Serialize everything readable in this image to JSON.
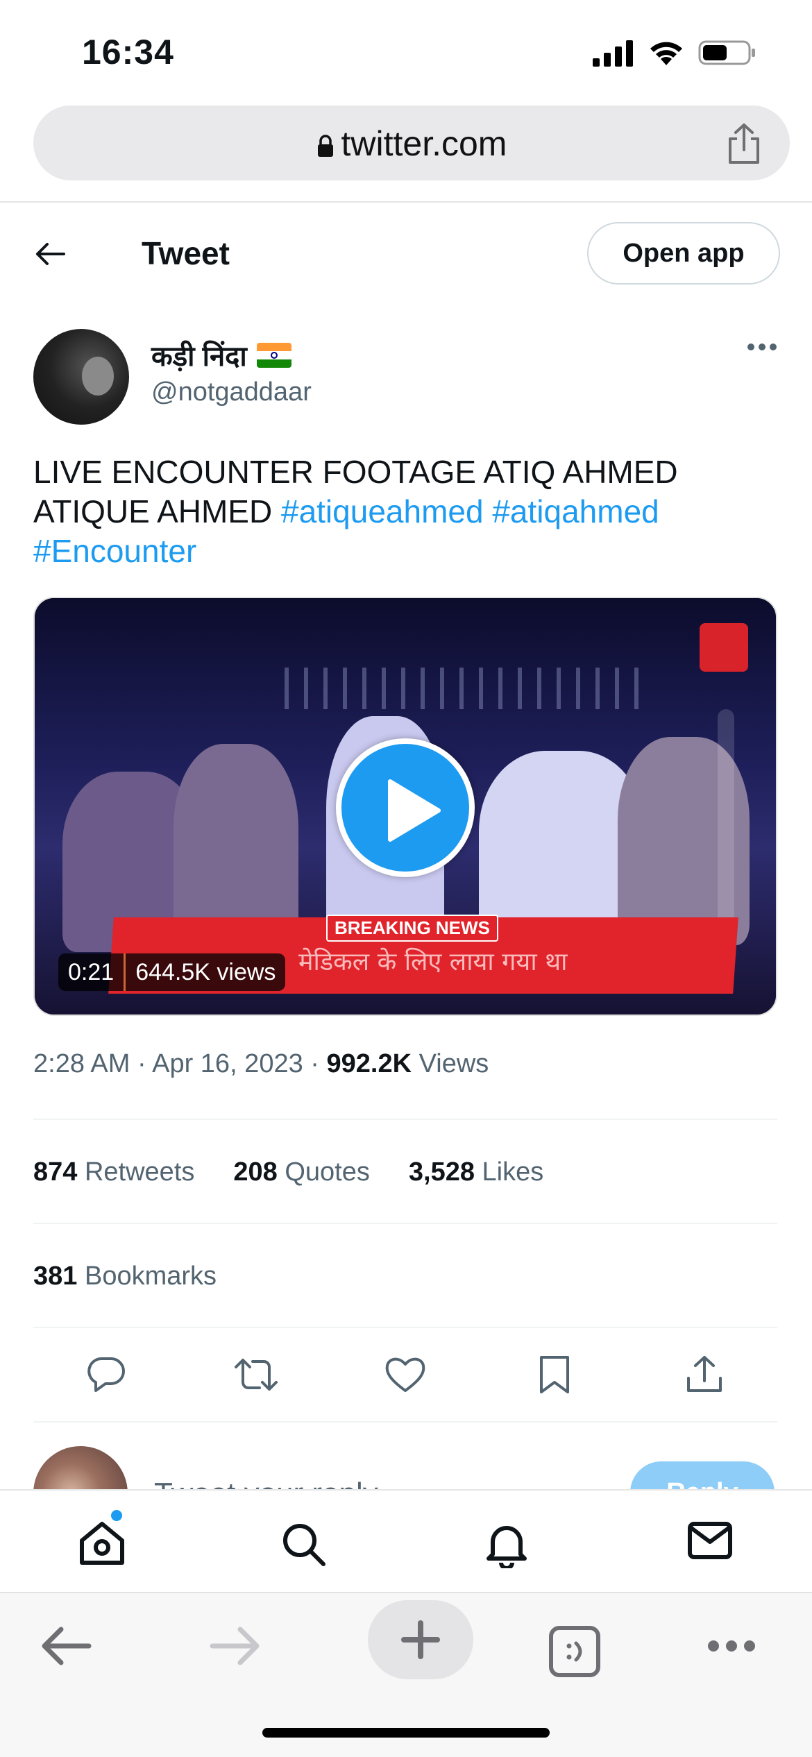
{
  "status_bar": {
    "time": "16:34"
  },
  "browser": {
    "url": "twitter.com"
  },
  "header": {
    "title": "Tweet",
    "open_app_label": "Open app"
  },
  "author": {
    "display_name": "कड़ी निंदा",
    "handle": "@notgaddaar"
  },
  "tweet": {
    "text_plain": "LIVE ENCOUNTER FOOTAGE ATIQ AHMED ATIQUE AHMED",
    "hashtags": [
      "#atiqueahmed",
      "#atiqahmed",
      "#Encounter"
    ]
  },
  "video": {
    "duration": "0:21",
    "views": "644.5K views",
    "banner_label": "BREAKING NEWS",
    "banner_text": "मेडिकल के लिए लाया गया था"
  },
  "meta": {
    "time": "2:28 AM",
    "date": "Apr 16, 2023",
    "views_count": "992.2K",
    "views_label": "Views"
  },
  "stats": {
    "retweets_count": "874",
    "retweets_label": "Retweets",
    "quotes_count": "208",
    "quotes_label": "Quotes",
    "likes_count": "3,528",
    "likes_label": "Likes",
    "bookmarks_count": "381",
    "bookmarks_label": "Bookmarks"
  },
  "reply": {
    "placeholder": "Tweet your reply",
    "button_label": "Reply"
  },
  "icons": {
    "status": [
      "signal-icon",
      "wifi-icon",
      "battery-icon"
    ],
    "actions": [
      "reply-icon",
      "retweet-icon",
      "like-icon",
      "bookmark-icon",
      "share-icon"
    ],
    "bottom_nav": [
      "home-icon",
      "search-icon",
      "notifications-icon",
      "messages-icon"
    ],
    "safari": [
      "back-icon",
      "forward-icon",
      "new-tab-icon",
      "tabs-icon",
      "more-icon"
    ]
  },
  "colors": {
    "accent": "#1d9bf0",
    "secondary_text": "#536471",
    "primary_text": "#0f1419"
  }
}
